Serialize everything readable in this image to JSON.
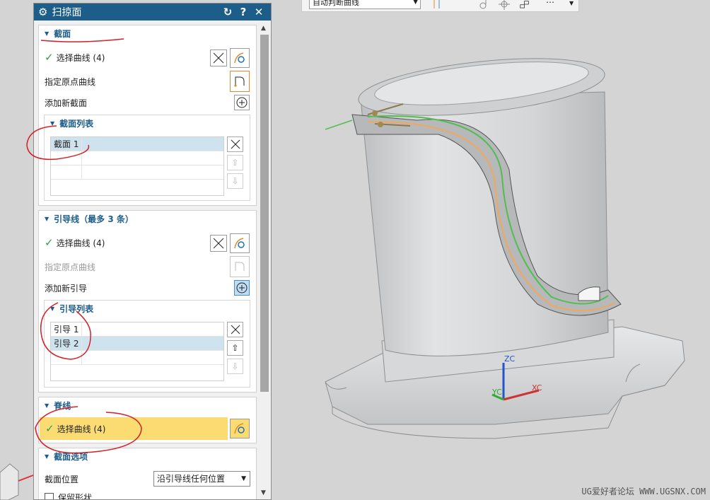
{
  "dialog": {
    "title": "扫掠面",
    "sections": {
      "section": {
        "title": "截面",
        "select_curve_label": "选择曲线 (4)",
        "origin_curve_label": "指定原点曲线",
        "add_new_label": "添加新截面",
        "list_title": "截面列表",
        "items": [
          "截面 1"
        ]
      },
      "guide": {
        "title": "引导线（最多 3 条）",
        "select_curve_label": "选择曲线 (4)",
        "origin_curve_label": "指定原点曲线",
        "add_new_label": "添加新引导",
        "list_title": "引导列表",
        "items": [
          "引导 1",
          "引导 2"
        ]
      },
      "spine": {
        "title": "脊线",
        "select_curve_label": "选择曲线 (4)"
      },
      "section_options": {
        "title": "截面选项",
        "position_label": "截面位置",
        "position_value": "沿引导线任何位置",
        "keep_shape_label": "保留形状"
      }
    }
  },
  "toolbar": {
    "filter_value": "自动判断曲线"
  },
  "viewport": {
    "axes": {
      "x": "XC",
      "y": "YC",
      "z": "ZC"
    },
    "watermark": "UG爱好者论坛  WWW.UGSNX.COM"
  },
  "colors": {
    "title_bar": "#1d5d8a",
    "highlight": "#fbdc73",
    "check": "#2ea043",
    "annotation": "#d61f26"
  }
}
